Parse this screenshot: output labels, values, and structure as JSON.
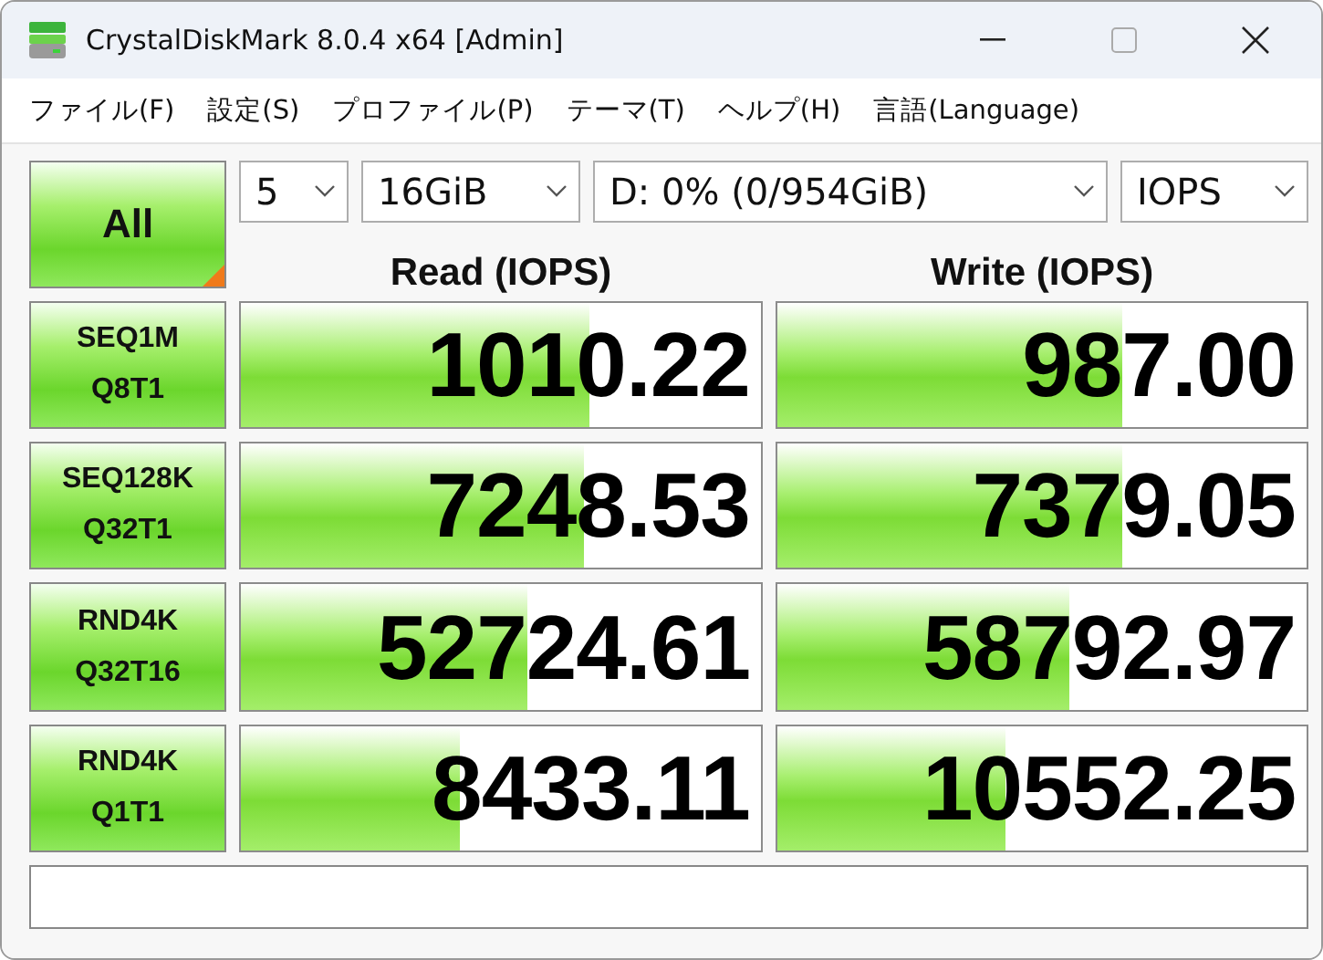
{
  "window": {
    "title": "CrystalDiskMark 8.0.4 x64 [Admin]"
  },
  "menu": [
    "ファイル(F)",
    "設定(S)",
    "プロファイル(P)",
    "テーマ(T)",
    "ヘルプ(H)",
    "言語(Language)"
  ],
  "all_button": {
    "label": "All"
  },
  "selects": [
    {
      "value": "5"
    },
    {
      "value": "16GiB"
    },
    {
      "value": "D: 0% (0/954GiB)"
    },
    {
      "value": "IOPS"
    }
  ],
  "columns": [
    "Read (IOPS)",
    "Write (IOPS)"
  ],
  "tests": [
    {
      "name": "SEQ1M",
      "params": "Q8T1",
      "read": {
        "value": "1010.22",
        "level": 0.67
      },
      "write": {
        "value": "987.00",
        "level": 0.65
      }
    },
    {
      "name": "SEQ128K",
      "params": "Q32T1",
      "read": {
        "value": "7248.53",
        "level": 0.66
      },
      "write": {
        "value": "7379.05",
        "level": 0.65
      }
    },
    {
      "name": "RND4K",
      "params": "Q32T16",
      "read": {
        "value": "52724.61",
        "level": 0.55
      },
      "write": {
        "value": "58792.97",
        "level": 0.55
      }
    },
    {
      "name": "RND4K",
      "params": "Q1T1",
      "read": {
        "value": "8433.11",
        "level": 0.42
      },
      "write": {
        "value": "10552.25",
        "level": 0.43
      }
    }
  ]
}
